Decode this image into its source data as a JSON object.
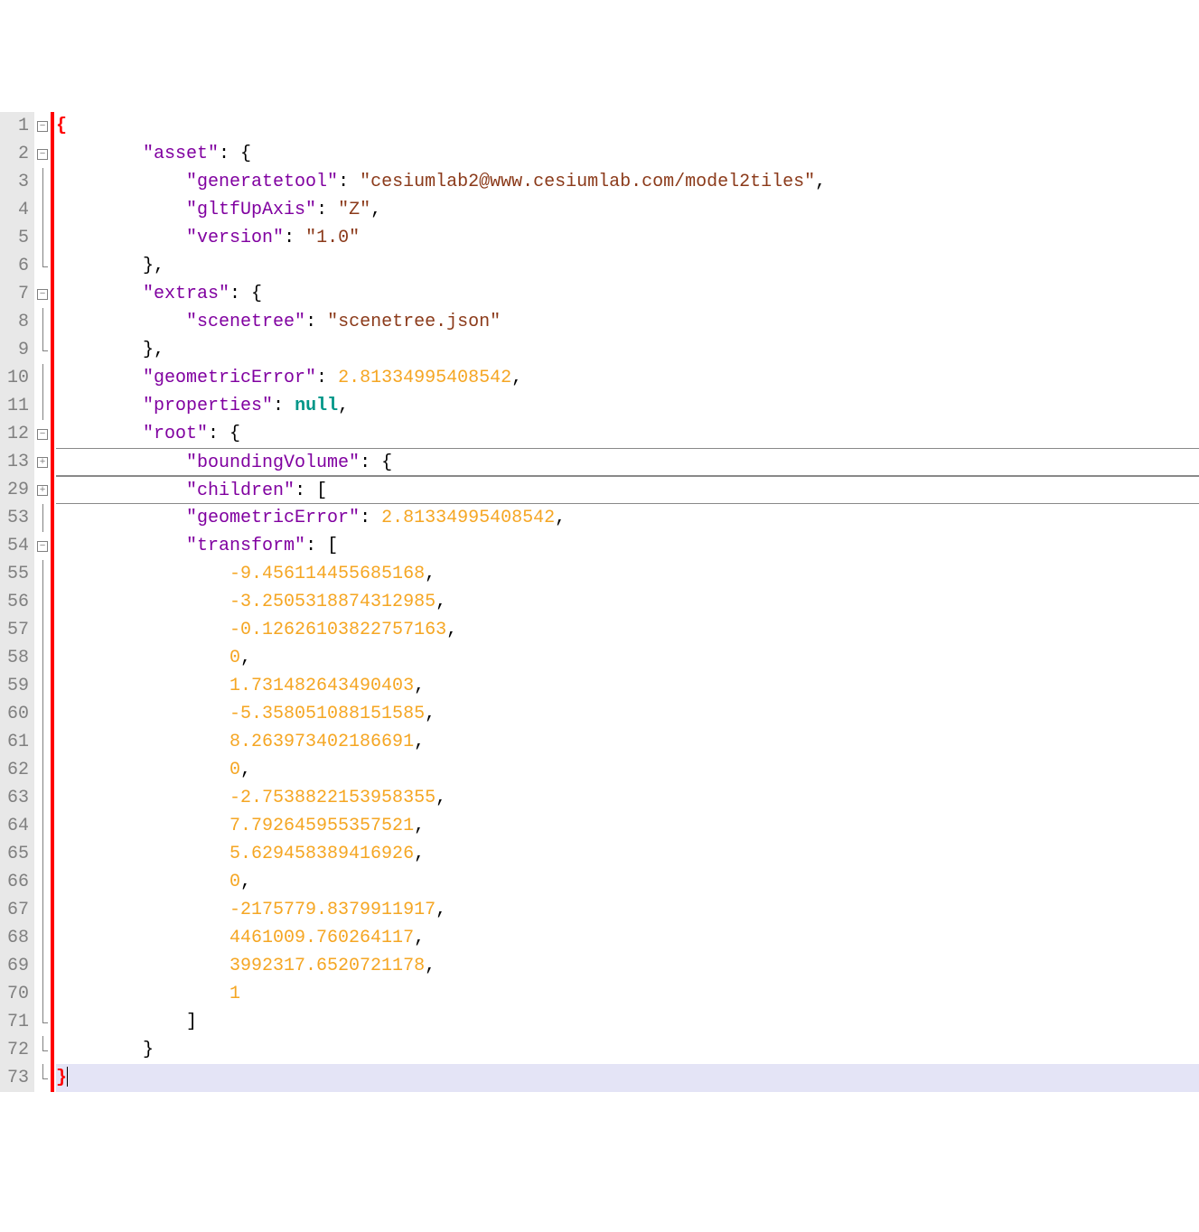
{
  "lines": [
    {
      "num": "1",
      "fold": "open",
      "red": true,
      "seg": [
        [
          "p bold",
          "{"
        ]
      ],
      "bold": true
    },
    {
      "num": "2",
      "fold": "open",
      "red": true,
      "seg": [
        [
          "p",
          "        "
        ],
        [
          "k",
          "\"asset\""
        ],
        [
          "p",
          ": {"
        ]
      ]
    },
    {
      "num": "3",
      "fold": "line",
      "red": true,
      "seg": [
        [
          "p",
          "            "
        ],
        [
          "k",
          "\"generatetool\""
        ],
        [
          "p",
          ": "
        ],
        [
          "s",
          "\"cesiumlab2@www.cesiumlab.com/model2tiles\""
        ],
        [
          "p",
          ","
        ]
      ]
    },
    {
      "num": "4",
      "fold": "line",
      "red": true,
      "seg": [
        [
          "p",
          "            "
        ],
        [
          "k",
          "\"gltfUpAxis\""
        ],
        [
          "p",
          ": "
        ],
        [
          "s",
          "\"Z\""
        ],
        [
          "p",
          ","
        ]
      ]
    },
    {
      "num": "5",
      "fold": "line",
      "red": true,
      "seg": [
        [
          "p",
          "            "
        ],
        [
          "k",
          "\"version\""
        ],
        [
          "p",
          ": "
        ],
        [
          "s",
          "\"1.0\""
        ]
      ]
    },
    {
      "num": "6",
      "fold": "end",
      "red": true,
      "seg": [
        [
          "p",
          "        },"
        ]
      ]
    },
    {
      "num": "7",
      "fold": "open",
      "red": true,
      "seg": [
        [
          "p",
          "        "
        ],
        [
          "k",
          "\"extras\""
        ],
        [
          "p",
          ": {"
        ]
      ]
    },
    {
      "num": "8",
      "fold": "line",
      "red": true,
      "seg": [
        [
          "p",
          "            "
        ],
        [
          "k",
          "\"scenetree\""
        ],
        [
          "p",
          ": "
        ],
        [
          "s",
          "\"scenetree.json\""
        ]
      ]
    },
    {
      "num": "9",
      "fold": "end",
      "red": true,
      "seg": [
        [
          "p",
          "        },"
        ]
      ]
    },
    {
      "num": "10",
      "fold": "line",
      "red": true,
      "seg": [
        [
          "p",
          "        "
        ],
        [
          "k",
          "\"geometricError\""
        ],
        [
          "p",
          ": "
        ],
        [
          "n",
          "2.81334995408542"
        ],
        [
          "p",
          ","
        ]
      ]
    },
    {
      "num": "11",
      "fold": "line",
      "red": true,
      "seg": [
        [
          "p",
          "        "
        ],
        [
          "k",
          "\"properties\""
        ],
        [
          "p",
          ": "
        ],
        [
          "kw",
          "null"
        ],
        [
          "p",
          ","
        ]
      ]
    },
    {
      "num": "12",
      "fold": "open",
      "red": true,
      "seg": [
        [
          "p",
          "        "
        ],
        [
          "k",
          "\"root\""
        ],
        [
          "p",
          ": {"
        ]
      ]
    },
    {
      "num": "13",
      "fold": "closed",
      "red": true,
      "collapsed": true,
      "seg": [
        [
          "p",
          "            "
        ],
        [
          "k",
          "\"boundingVolume\""
        ],
        [
          "p",
          ": {"
        ]
      ]
    },
    {
      "num": "29",
      "fold": "closed",
      "red": true,
      "collapsed": true,
      "seg": [
        [
          "p",
          "            "
        ],
        [
          "k",
          "\"children\""
        ],
        [
          "p",
          ": ["
        ]
      ]
    },
    {
      "num": "53",
      "fold": "line",
      "red": true,
      "seg": [
        [
          "p",
          "            "
        ],
        [
          "k",
          "\"geometricError\""
        ],
        [
          "p",
          ": "
        ],
        [
          "n",
          "2.81334995408542"
        ],
        [
          "p",
          ","
        ]
      ]
    },
    {
      "num": "54",
      "fold": "open",
      "red": true,
      "seg": [
        [
          "p",
          "            "
        ],
        [
          "k",
          "\"transform\""
        ],
        [
          "p",
          ": ["
        ]
      ]
    },
    {
      "num": "55",
      "fold": "line",
      "red": true,
      "seg": [
        [
          "p",
          "                "
        ],
        [
          "n",
          "-9.456114455685168"
        ],
        [
          "p",
          ","
        ]
      ]
    },
    {
      "num": "56",
      "fold": "line",
      "red": true,
      "seg": [
        [
          "p",
          "                "
        ],
        [
          "n",
          "-3.2505318874312985"
        ],
        [
          "p",
          ","
        ]
      ]
    },
    {
      "num": "57",
      "fold": "line",
      "red": true,
      "seg": [
        [
          "p",
          "                "
        ],
        [
          "n",
          "-0.12626103822757163"
        ],
        [
          "p",
          ","
        ]
      ]
    },
    {
      "num": "58",
      "fold": "line",
      "red": true,
      "seg": [
        [
          "p",
          "                "
        ],
        [
          "n",
          "0"
        ],
        [
          "p",
          ","
        ]
      ]
    },
    {
      "num": "59",
      "fold": "line",
      "red": true,
      "seg": [
        [
          "p",
          "                "
        ],
        [
          "n",
          "1.731482643490403"
        ],
        [
          "p",
          ","
        ]
      ]
    },
    {
      "num": "60",
      "fold": "line",
      "red": true,
      "seg": [
        [
          "p",
          "                "
        ],
        [
          "n",
          "-5.358051088151585"
        ],
        [
          "p",
          ","
        ]
      ]
    },
    {
      "num": "61",
      "fold": "line",
      "red": true,
      "seg": [
        [
          "p",
          "                "
        ],
        [
          "n",
          "8.263973402186691"
        ],
        [
          "p",
          ","
        ]
      ]
    },
    {
      "num": "62",
      "fold": "line",
      "red": true,
      "seg": [
        [
          "p",
          "                "
        ],
        [
          "n",
          "0"
        ],
        [
          "p",
          ","
        ]
      ]
    },
    {
      "num": "63",
      "fold": "line",
      "red": true,
      "seg": [
        [
          "p",
          "                "
        ],
        [
          "n",
          "-2.7538822153958355"
        ],
        [
          "p",
          ","
        ]
      ]
    },
    {
      "num": "64",
      "fold": "line",
      "red": true,
      "seg": [
        [
          "p",
          "                "
        ],
        [
          "n",
          "7.792645955357521"
        ],
        [
          "p",
          ","
        ]
      ]
    },
    {
      "num": "65",
      "fold": "line",
      "red": true,
      "seg": [
        [
          "p",
          "                "
        ],
        [
          "n",
          "5.629458389416926"
        ],
        [
          "p",
          ","
        ]
      ]
    },
    {
      "num": "66",
      "fold": "line",
      "red": true,
      "seg": [
        [
          "p",
          "                "
        ],
        [
          "n",
          "0"
        ],
        [
          "p",
          ","
        ]
      ]
    },
    {
      "num": "67",
      "fold": "line",
      "red": true,
      "seg": [
        [
          "p",
          "                "
        ],
        [
          "n",
          "-2175779.8379911917"
        ],
        [
          "p",
          ","
        ]
      ]
    },
    {
      "num": "68",
      "fold": "line",
      "red": true,
      "seg": [
        [
          "p",
          "                "
        ],
        [
          "n",
          "4461009.760264117"
        ],
        [
          "p",
          ","
        ]
      ]
    },
    {
      "num": "69",
      "fold": "line",
      "red": true,
      "seg": [
        [
          "p",
          "                "
        ],
        [
          "n",
          "3992317.6520721178"
        ],
        [
          "p",
          ","
        ]
      ]
    },
    {
      "num": "70",
      "fold": "line",
      "red": true,
      "seg": [
        [
          "p",
          "                "
        ],
        [
          "n",
          "1"
        ]
      ]
    },
    {
      "num": "71",
      "fold": "end",
      "red": true,
      "seg": [
        [
          "p",
          "            ]"
        ]
      ]
    },
    {
      "num": "72",
      "fold": "end",
      "red": true,
      "seg": [
        [
          "p",
          "        }"
        ]
      ]
    },
    {
      "num": "73",
      "fold": "end",
      "red": true,
      "highlight": true,
      "cursor": true,
      "seg": [
        [
          "p bold",
          "}"
        ]
      ],
      "bold": true,
      "endcolor": "red"
    }
  ]
}
